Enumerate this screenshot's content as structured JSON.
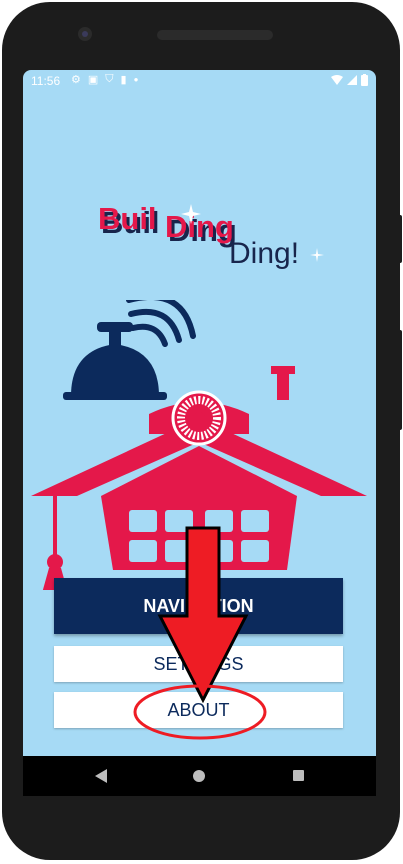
{
  "status_bar": {
    "time": "11:56",
    "icons": [
      "gear-icon",
      "box-icon",
      "shield-icon",
      "sd-card-icon",
      "dot-icon"
    ],
    "right_icons": [
      "wifi-icon",
      "signal-icon",
      "battery-icon"
    ]
  },
  "logo": {
    "word1": "Buil",
    "word2": "Ding",
    "word3": "Ding!"
  },
  "menu": {
    "navigation_label": "NAVIGATION",
    "settings_label": "SETTINGS",
    "about_label": "ABOUT"
  },
  "colors": {
    "background": "#a6daf5",
    "school_red": "#e4184a",
    "navy": "#0c2a5c",
    "arrow_red": "#ee1c24"
  },
  "nav_bar": {
    "icons": [
      "back-icon",
      "home-icon",
      "recents-icon"
    ]
  }
}
